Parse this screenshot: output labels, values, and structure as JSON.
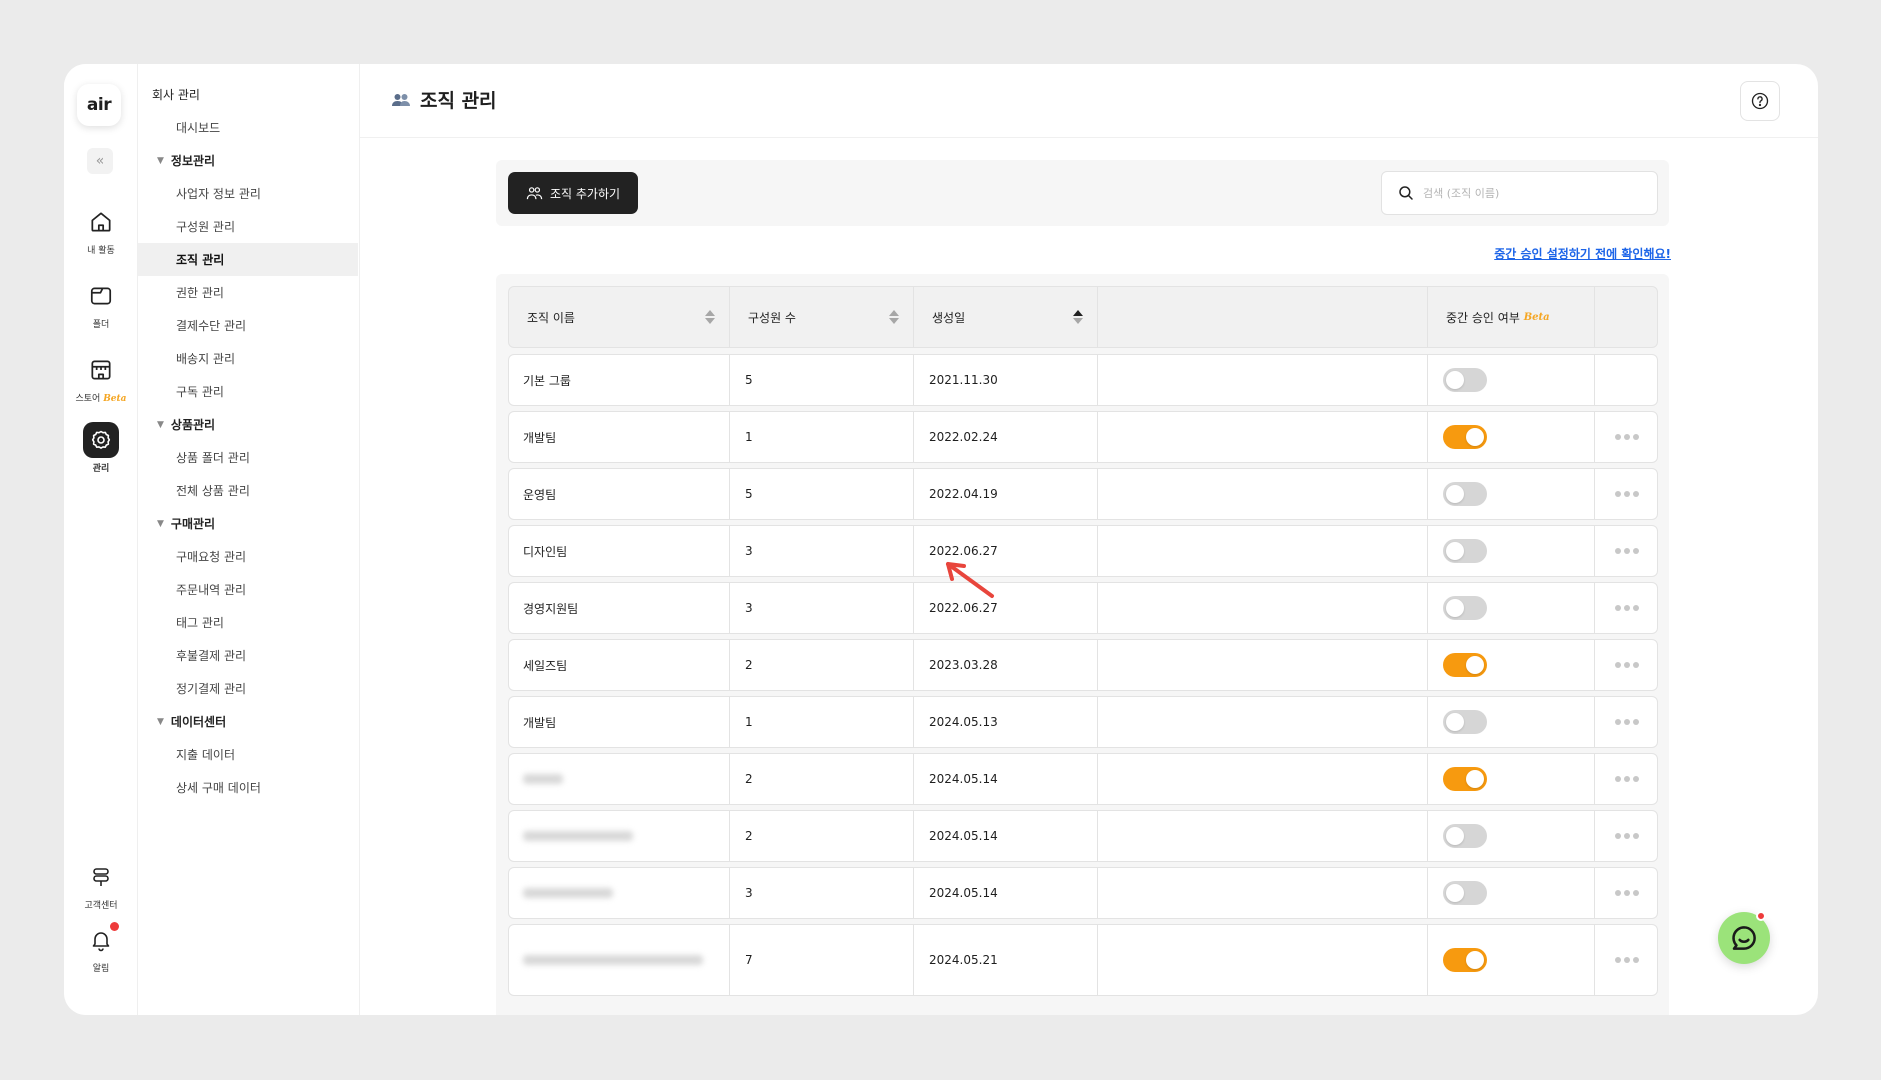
{
  "rail": {
    "logo": "air",
    "collapse_icon": "«",
    "items": [
      {
        "label": "내 활동",
        "icon": "home-icon"
      },
      {
        "label": "폴더",
        "icon": "folder-icon"
      },
      {
        "label": "스토어",
        "beta": "Beta",
        "icon": "store-icon"
      },
      {
        "label": "관리",
        "icon": "gear-icon"
      }
    ],
    "bottom": [
      {
        "label": "고객센터",
        "icon": "signpost-icon"
      },
      {
        "label": "알림",
        "icon": "bell-icon"
      }
    ]
  },
  "menu": {
    "root": "회사 관리",
    "dashboard": "대시보드",
    "groups": [
      {
        "label": "정보관리",
        "items": [
          "사업자 정보 관리",
          "구성원 관리",
          "조직 관리",
          "권한 관리",
          "결제수단 관리",
          "배송지 관리",
          "구독 관리"
        ]
      },
      {
        "label": "상품관리",
        "items": [
          "상품 폴더 관리",
          "전체 상품 관리"
        ]
      },
      {
        "label": "구매관리",
        "items": [
          "구매요청 관리",
          "주문내역 관리",
          "태그 관리",
          "후불결제 관리",
          "정기결제 관리"
        ]
      },
      {
        "label": "데이터센터",
        "items": [
          "지출 데이터",
          "상세 구매 데이터"
        ]
      }
    ],
    "active": "조직 관리"
  },
  "header": {
    "title": "조직 관리",
    "help_icon": "question-icon"
  },
  "toolbar": {
    "add_label": "조직 추가하기",
    "search_placeholder": "검색 (조직 이름)"
  },
  "note_link": "중간 승인 설정하기 전에 확인해요!",
  "table": {
    "columns": [
      "조직 이름",
      "구성원 수",
      "생성일",
      "",
      "중간 승인 여부",
      ""
    ],
    "approval_beta": "Beta",
    "rows": [
      {
        "name": "기본 그룹",
        "members": "5",
        "created": "2021.11.30",
        "approval": false,
        "menu": false
      },
      {
        "name": "개발팀",
        "members": "1",
        "created": "2022.02.24",
        "approval": true,
        "menu": true
      },
      {
        "name": "운영팀",
        "members": "5",
        "created": "2022.04.19",
        "approval": false,
        "menu": true
      },
      {
        "name": "디자인팀",
        "members": "3",
        "created": "2022.06.27",
        "approval": false,
        "menu": true
      },
      {
        "name": "경영지원팀",
        "members": "3",
        "created": "2022.06.27",
        "approval": false,
        "menu": true
      },
      {
        "name": "세일즈팀",
        "members": "2",
        "created": "2023.03.28",
        "approval": true,
        "menu": true
      },
      {
        "name": "개발팀",
        "members": "1",
        "created": "2024.05.13",
        "approval": false,
        "menu": true
      },
      {
        "name": "",
        "members": "2",
        "created": "2024.05.14",
        "approval": true,
        "menu": true,
        "blurred": true
      },
      {
        "name": "",
        "members": "2",
        "created": "2024.05.14",
        "approval": false,
        "menu": true,
        "blurred": true
      },
      {
        "name": "",
        "members": "3",
        "created": "2024.05.14",
        "approval": false,
        "menu": true,
        "blurred": true
      },
      {
        "name": "",
        "members": "7",
        "created": "2024.05.21",
        "approval": true,
        "menu": true,
        "blurred": true
      }
    ]
  },
  "colors": {
    "accent": "#f79a0f",
    "link": "#1c64e8",
    "arrow": "#e8453c",
    "chat": "#9be37a"
  }
}
